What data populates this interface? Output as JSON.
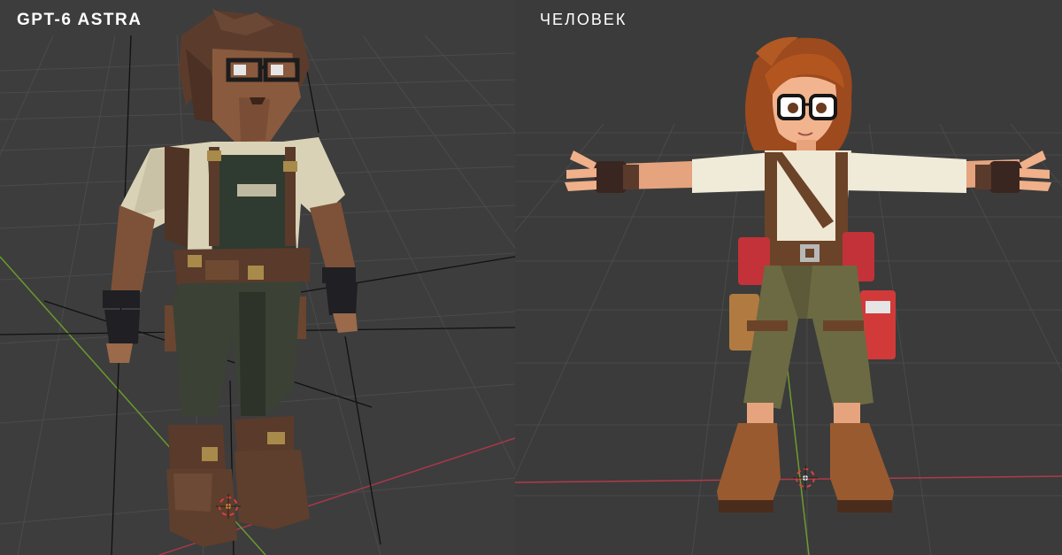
{
  "panels": {
    "left": {
      "title": "GPT-6 ASTRA",
      "content": "low-poly-character-model"
    },
    "right": {
      "title": "ЧЕЛОВЕК",
      "content": "stylized-character-model"
    }
  },
  "colors": {
    "viewport_bg": "#3b3b3b",
    "grid_line": "#4a4a4a",
    "axis_x": "#b03a48",
    "axis_y": "#6f9a2e",
    "cursor": "#ff8a3d"
  }
}
